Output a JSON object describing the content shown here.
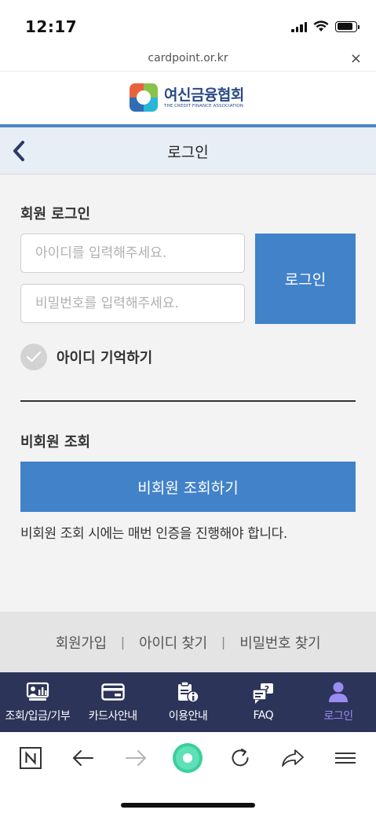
{
  "status": {
    "time": "12:17",
    "battery_level": 0.85
  },
  "browser": {
    "url": "cardpoint.or.kr",
    "close_symbol": "×",
    "toolbar": [
      "n-icon",
      "back-arrow-icon",
      "forward-arrow-icon",
      "home-dot-icon",
      "reload-icon",
      "share-icon",
      "menu-icon"
    ]
  },
  "header": {
    "logo_text": "여신금융협회",
    "logo_subtext": "THE CREDIT FINANCE ASSOCIATION"
  },
  "title_bar": {
    "title": "로그인",
    "back_icon": "chevron-left-icon"
  },
  "member_login": {
    "section_title": "회원 로그인",
    "id_placeholder": "아이디를 입력해주세요.",
    "id_value": "",
    "password_placeholder": "비밀번호를 입력해주세요.",
    "password_value": "",
    "login_button": "로그인",
    "remember_label": "아이디 기억하기",
    "remember_checked": false
  },
  "guest": {
    "section_title": "비회원 조회",
    "button": "비회원 조회하기",
    "note": "비회원 조회 시에는 매번 인증을 진행해야 합니다."
  },
  "footer_links": {
    "signup": "회원가입",
    "find_id": "아이디 찾기",
    "find_password": "비밀번호 찾기",
    "separator": "|"
  },
  "tab_bar": {
    "items": [
      {
        "label": "조회/입금/기부",
        "icon": "monitor-chart-icon"
      },
      {
        "label": "카드사안내",
        "icon": "card-icon"
      },
      {
        "label": "이용안내",
        "icon": "clipboard-info-icon"
      },
      {
        "label": "FAQ",
        "icon": "faq-chat-icon"
      },
      {
        "label": "로그인",
        "icon": "person-icon"
      }
    ],
    "active_index": 4,
    "active_color": "#9b8cf3",
    "background": "#2c3459"
  },
  "colors": {
    "primary_button": "#4282c9",
    "header_accent": "#4a86c8",
    "title_bar_bg": "#e8eef6"
  }
}
